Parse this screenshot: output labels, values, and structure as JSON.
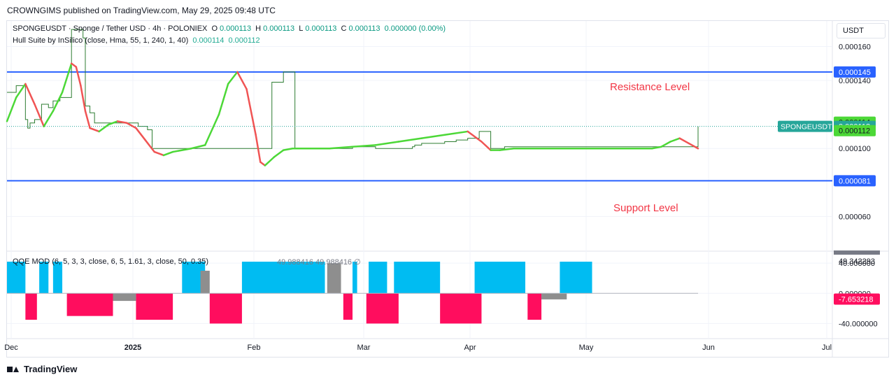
{
  "header": {
    "publisher_line": "CROWNGIMS published on TradingView.com, May 29, 2025 09:48 UTC"
  },
  "legend": {
    "symbol_line": "SPONGEUSDT · Sponge / Tether USD · 4h · POLONIEX",
    "open_label": "O",
    "open": "0.000113",
    "high_label": "H",
    "high": "0.000113",
    "low_label": "L",
    "low": "0.000113",
    "close_label": "C",
    "close": "0.000113",
    "change": "0.000000 (0.00%)",
    "indicator_line": "Hull Suite by InSilico (close, Hma, 55, 1, 240, 1, 40)",
    "hull_value_1": "0.000114",
    "hull_value_2": "0.000112"
  },
  "qqe_legend": {
    "label": "QQE MOD (6, 5, 3, 3, close, 6, 5, 1.61, 3, close, 50, 0.35)",
    "values": "49.988416  49.988416  ∅"
  },
  "price_scale": {
    "unit": "USDT",
    "badges": {
      "resistance": "0.000145",
      "hull_upper": "0.000114",
      "symbol_tag": "SPONGEUSDT",
      "current": "0.000113",
      "hull_lower": "0.000112",
      "support": "0.000081"
    },
    "qqe_badges": {
      "upper": "49.342293",
      "lower": "-7.653218"
    }
  },
  "colors": {
    "line_blue": "#2962ff",
    "hull_green": "#4cd837",
    "hull_red": "#f05454",
    "price_line": "#2e7d32",
    "current_tag": "#26a69a",
    "qqe_blue": "#00bcf2",
    "qqe_pink": "#ff0d5e",
    "qqe_gray": "#8e8e8e",
    "annotation_red": "#f23645"
  },
  "annotations": {
    "resistance": "Resistance Level",
    "support": "Support Level"
  },
  "footer": {
    "brand": "TradingView"
  },
  "chart_data": [
    {
      "type": "line",
      "title": "SPONGEUSDT · Sponge / Tether USD · 4h · POLONIEX",
      "y_ticks": [
        "0.000160",
        "0.000140",
        "0.000100",
        "0.000060"
      ],
      "y_tick_values": [
        0.00016,
        0.00014,
        0.0001,
        6e-05
      ],
      "x_ticks": [
        "Dec",
        "2025",
        "Feb",
        "Mar",
        "Apr",
        "May",
        "Jun",
        "Jul"
      ],
      "ylim": [
        4e-05,
        0.000175
      ],
      "horizontal_levels": [
        {
          "name": "Resistance Level",
          "value": 0.000145
        },
        {
          "name": "Support Level",
          "value": 8.1e-05
        }
      ],
      "series": [
        {
          "name": "Price",
          "x": [
            0,
            2,
            4,
            6,
            8,
            9,
            10,
            12,
            15,
            18,
            20,
            23,
            28,
            33,
            34,
            36,
            38,
            40,
            42,
            44,
            45,
            50,
            55,
            57,
            59,
            60,
            61,
            62,
            63,
            64,
            66,
            70,
            75,
            82,
            90,
            95,
            100,
            110,
            114,
            115,
            117,
            120,
            125,
            130,
            135,
            140,
            142,
            143,
            145,
            150,
            160,
            170,
            176,
            177,
            180,
            190,
            195,
            200,
            205,
            210,
            216,
            220,
            225,
            230,
            240,
            250,
            252,
            253,
            255,
            260,
            270,
            275,
            280,
            282,
            283,
            285,
            290,
            296,
            297,
            299,
            300
          ],
          "values": [
            0.000133,
            0.000133,
            0.000137,
            0.000137,
            0.000117,
            0.000112,
            0.000115,
            0.000117,
            0.000126,
            0.000124,
            0.000128,
            0.00013,
            0.00017,
            0.000165,
            0.000125,
            0.000121,
            0.000115,
            0.000115,
            0.000115,
            0.000115,
            0.000115,
            0.000115,
            0.000115,
            0.000113,
            0.000113,
            0.000113,
            0.000111,
            0.000111,
            0.0001,
            0.0001,
            0.0001,
            0.0001,
            0.0001,
            0.0001,
            0.0001,
            0.0001,
            0.0001,
            0.0001,
            0.0001,
            0.000139,
            0.000139,
            0.000145,
            0.0001,
            0.0001,
            0.0001,
            0.0001,
            0.0001,
            0.0001,
            0.0001,
            0.000101,
            0.0001,
            0.0001,
            0.000101,
            0.000102,
            0.000103,
            0.000104,
            0.000105,
            0.000106,
            0.00011,
            0.0001,
            0.000101,
            0.000101,
            0.000101,
            0.000101,
            0.000101,
            0.000101,
            0.000101,
            0.000101,
            0.000101,
            0.000101,
            0.000101,
            0.000101,
            0.000101,
            0.000101,
            0.000101,
            0.000101,
            0.000101,
            0.000101,
            0.000101,
            0.000101,
            0.000113
          ]
        },
        {
          "name": "Hull Suite",
          "x": [
            0,
            4,
            8,
            12,
            16,
            20,
            24,
            28,
            30,
            32,
            34,
            36,
            40,
            44,
            48,
            52,
            56,
            60,
            64,
            68,
            72,
            80,
            86,
            92,
            96,
            100,
            104,
            108,
            110,
            112,
            116,
            120,
            124,
            128,
            132,
            136,
            140,
            150,
            160,
            170,
            180,
            190,
            200,
            206,
            210,
            214,
            220,
            230,
            240,
            250,
            260,
            270,
            280,
            284,
            288,
            292,
            296,
            300
          ],
          "values": [
            0.000116,
            0.00013,
            0.000138,
            0.000126,
            0.000113,
            0.000122,
            0.000133,
            0.00015,
            0.000148,
            0.000137,
            0.000122,
            0.000112,
            0.00011,
            0.000114,
            0.000116,
            0.000115,
            0.000112,
            0.000105,
            9.8e-05,
            9.6e-05,
            9.8e-05,
            0.0001,
            0.000102,
            0.00012,
            0.000138,
            0.000145,
            0.000135,
            0.000108,
            9.2e-05,
            9e-05,
            9.5e-05,
            9.9e-05,
            0.0001,
            0.0001,
            0.0001,
            0.0001,
            0.0001,
            0.000101,
            0.000102,
            0.000104,
            0.000106,
            0.000108,
            0.00011,
            0.000104,
            9.9e-05,
            9.9e-05,
            0.0001,
            0.0001,
            0.0001,
            0.0001,
            0.0001,
            0.0001,
            0.0001,
            0.000101,
            0.000104,
            0.000106,
            0.000103,
            0.0001
          ]
        }
      ]
    },
    {
      "type": "bar",
      "title": "QQE MOD (6, 5, 3, 3, close, 6, 5, 1.61, 3, close, 50, 0.35)",
      "y_ticks": [
        "40.000000",
        "0.000000",
        "-40.000000"
      ],
      "y_tick_values": [
        40,
        0,
        -40
      ],
      "ylim": [
        -60,
        55
      ],
      "series": [
        {
          "name": "Blue",
          "x_ranges": [
            [
              0,
              8
            ],
            [
              14,
              18
            ],
            [
              20,
              24
            ],
            [
              76,
              86
            ],
            [
              102,
              138
            ],
            [
              150,
              152
            ],
            [
              157,
              165
            ],
            [
              168,
              188
            ],
            [
              203,
              225
            ],
            [
              240,
              254
            ]
          ],
          "values": [
            42,
            42,
            42,
            42,
            42,
            42,
            42,
            42,
            42,
            42
          ]
        },
        {
          "name": "Pink",
          "x_ranges": [
            [
              8,
              13
            ],
            [
              26,
              46
            ],
            [
              56,
              72
            ],
            [
              88,
              102
            ],
            [
              146,
              150
            ],
            [
              156,
              170
            ],
            [
              188,
              206
            ],
            [
              226,
              232
            ]
          ],
          "values": [
            -35,
            -30,
            -35,
            -40,
            -35,
            -40,
            -40,
            -35
          ]
        },
        {
          "name": "Gray",
          "x_ranges": [
            [
              46,
              56
            ],
            [
              84,
              88
            ],
            [
              139,
              145
            ],
            [
              232,
              243
            ]
          ],
          "values": [
            -10,
            30,
            40,
            -8
          ]
        }
      ]
    }
  ]
}
